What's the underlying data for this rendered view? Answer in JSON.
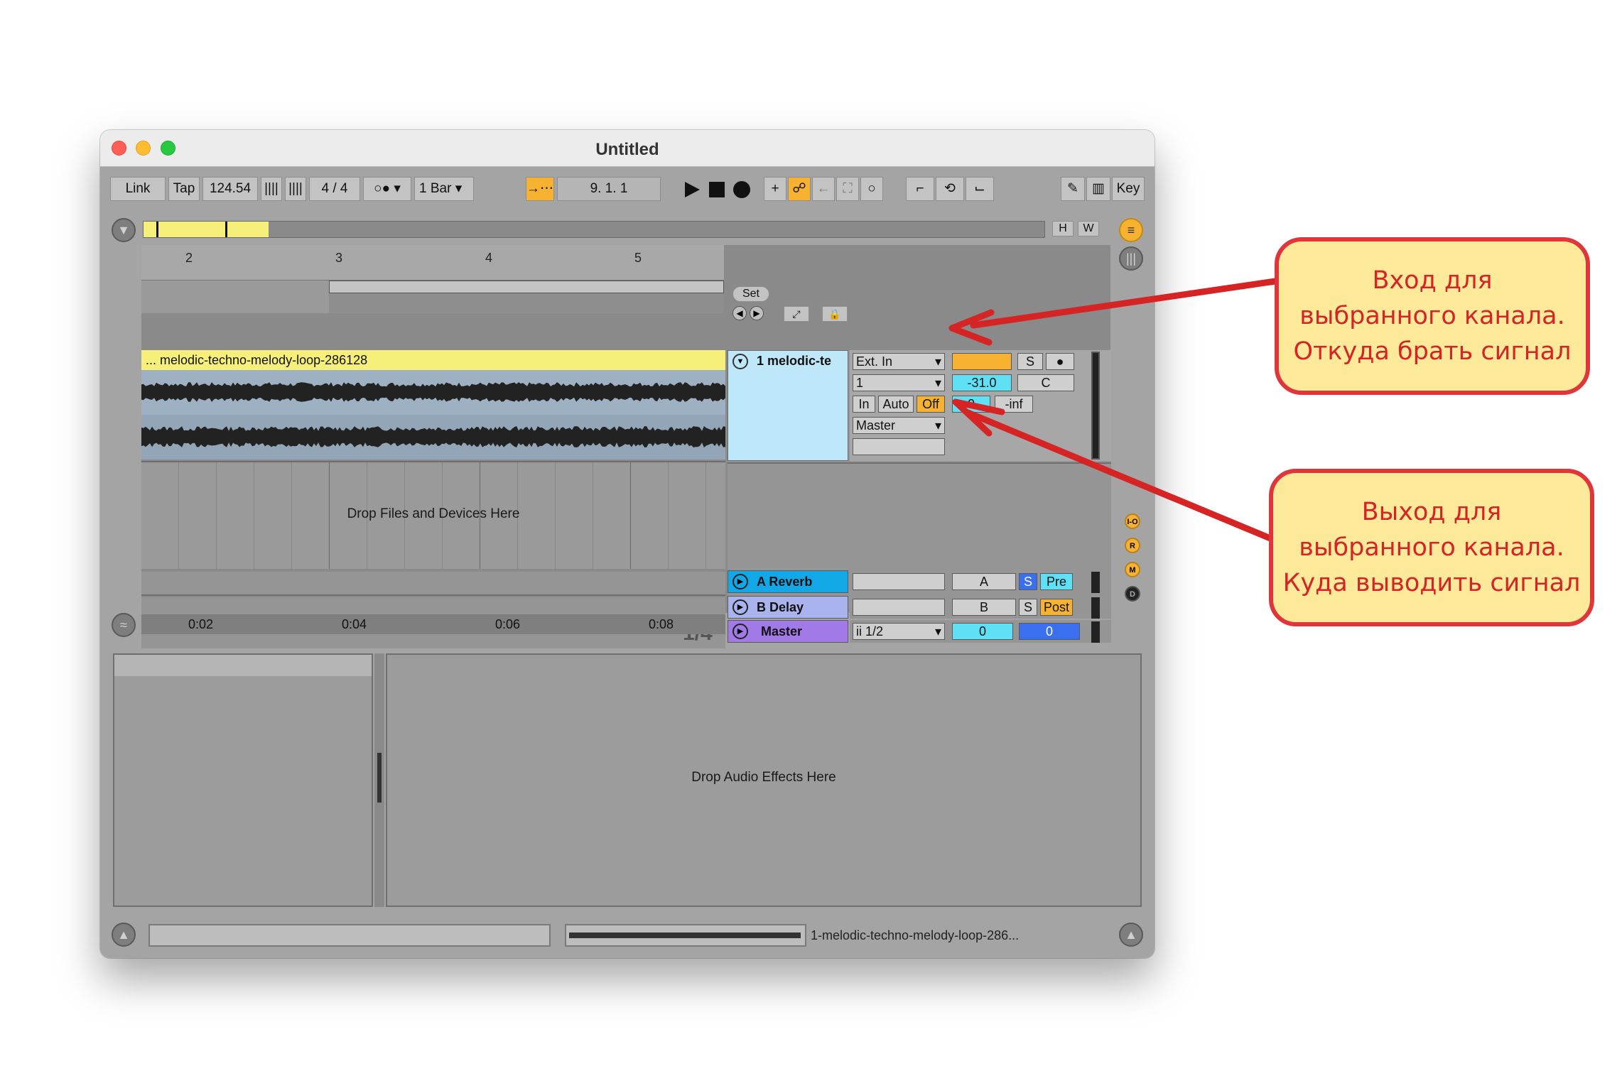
{
  "window": {
    "title": "Untitled"
  },
  "controlbar": {
    "link": "Link",
    "tap": "Tap",
    "tempo": "124.54",
    "time_signature": "4 / 4",
    "metronome": "○●",
    "quantization": "1 Bar",
    "position": "9.  1.  1",
    "key": "Key"
  },
  "overview": {
    "h": "H",
    "w": "W"
  },
  "ruler": {
    "bars": [
      "2",
      "3",
      "4",
      "5"
    ],
    "set_label": "Set"
  },
  "clip": {
    "name": "... melodic-techno-melody-loop-286128"
  },
  "arrangement": {
    "drop_label": "Drop Files and Devices Here",
    "zoom_ratio": "1/4",
    "time_ticks": [
      "0:02",
      "0:04",
      "0:06",
      "0:08"
    ]
  },
  "track1": {
    "name": "1 melodic-te",
    "input_type": "Ext. In",
    "input_channel": "1",
    "monitor": [
      "In",
      "Auto",
      "Off"
    ],
    "output": "Master",
    "volume": "-31.0",
    "pan": "C",
    "send_a": "0",
    "send_b": "-inf",
    "solo": "S",
    "arm": "●"
  },
  "returns": [
    {
      "name": "A Reverb",
      "send": "A",
      "solo": "S",
      "mode": "Pre"
    },
    {
      "name": "B Delay",
      "send": "B",
      "solo": "S",
      "mode": "Post"
    }
  ],
  "master": {
    "name": "Master",
    "cue": "ii 1/2",
    "volume": "0",
    "pan": "0"
  },
  "side_indicators": [
    "I-O",
    "R",
    "M",
    "D"
  ],
  "device_panel": {
    "drop_label": "Drop Audio Effects Here"
  },
  "status": {
    "selected_clip": "1-melodic-techno-melody-loop-286..."
  },
  "callouts": {
    "input": [
      "Вход для",
      "выбранного канала.",
      "Откуда брать сигнал"
    ],
    "output": [
      "Выход для",
      "выбранного канала.",
      "Куда выводить сигнал"
    ]
  },
  "colors": {
    "clip_yellow": "#f6f07a",
    "track_blue": "#bfe7fa",
    "return_a": "#12a7e6",
    "return_b": "#a9b4ef",
    "master": "#a27ae8",
    "accent_orange": "#f7b231",
    "callout_red": "#e0353a",
    "callout_fill": "#fde99a"
  }
}
